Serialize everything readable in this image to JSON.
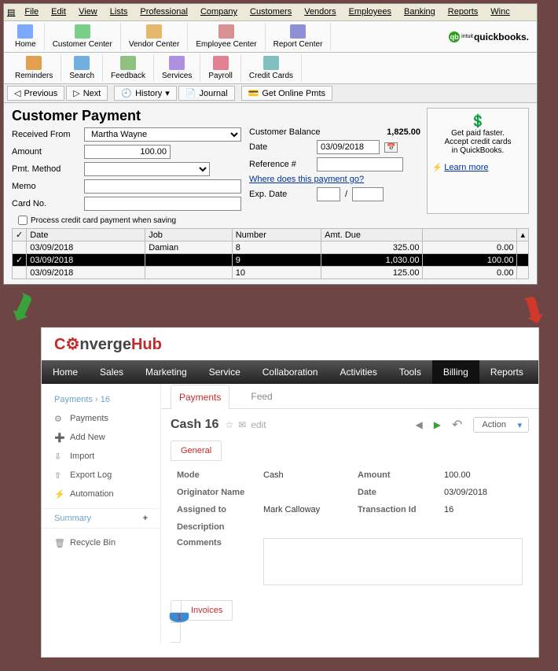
{
  "qb": {
    "menu": [
      "File",
      "Edit",
      "View",
      "Lists",
      "Professional",
      "Company",
      "Customers",
      "Vendors",
      "Employees",
      "Banking",
      "Reports",
      "Winc"
    ],
    "toolbar1": [
      {
        "label": "Home",
        "color": "#7aa9ff"
      },
      {
        "label": "Customer Center",
        "color": "#7ad088"
      },
      {
        "label": "Vendor Center",
        "color": "#e6b86a"
      },
      {
        "label": "Employee Center",
        "color": "#d89090"
      },
      {
        "label": "Report Center",
        "color": "#9090d8"
      }
    ],
    "brand_small": "intuit",
    "brand": "quickbooks",
    "toolbar2": [
      {
        "label": "Reminders",
        "color": "#e0a050"
      },
      {
        "label": "Search",
        "color": "#70b0e0"
      },
      {
        "label": "Feedback",
        "color": "#90c080"
      },
      {
        "label": "Services",
        "color": "#b090e0"
      },
      {
        "label": "Payroll",
        "color": "#e08090"
      },
      {
        "label": "Credit Cards",
        "color": "#80c0c0"
      }
    ],
    "nav": {
      "prev": "Previous",
      "next": "Next",
      "history": "History",
      "journal": "Journal",
      "online": "Get Online Pmts"
    },
    "title": "Customer Payment",
    "received_label": "Received From",
    "received_value": "Martha Wayne",
    "bal_label": "Customer Balance",
    "bal_value": "1,825.00",
    "amount_label": "Amount",
    "amount_value": "100.00",
    "date_label": "Date",
    "date_value": "03/09/2018",
    "pmt_label": "Pmt. Method",
    "pmt_value": "",
    "ref_label": "Reference #",
    "ref_value": "",
    "memo_label": "Memo",
    "memo_value": "",
    "where_link": "Where does this payment go?",
    "card_label": "Card No.",
    "card_value": "",
    "exp_label": "Exp. Date",
    "exp_m": "",
    "exp_y": "",
    "process_label": "Process credit card payment when saving",
    "promo": {
      "line1": "Get paid faster.",
      "line2": "Accept credit cards",
      "line3": "in QuickBooks.",
      "learn": "Learn more"
    },
    "table": {
      "headers": {
        "check": "✓",
        "date": "Date",
        "job": "Job",
        "number": "Number",
        "amtdue": "Amt. Due",
        "last": ""
      },
      "rows": [
        {
          "date": "03/09/2018",
          "job": "Damian",
          "number": "8",
          "amtdue": "325.00",
          "last": "0.00",
          "sel": false
        },
        {
          "date": "03/09/2018",
          "job": "",
          "number": "9",
          "amtdue": "1,030.00",
          "last": "100.00",
          "sel": true
        },
        {
          "date": "03/09/2018",
          "job": "",
          "number": "10",
          "amtdue": "125.00",
          "last": "0.00",
          "sel": false
        }
      ]
    }
  },
  "ch": {
    "logo": {
      "c": "C",
      "mid": "nverge",
      "hub": "Hub"
    },
    "nav": [
      "Home",
      "Sales",
      "Marketing",
      "Service",
      "Collaboration",
      "Activities",
      "Tools",
      "Billing",
      "Reports"
    ],
    "nav_active": "Billing",
    "breadcrumb": {
      "a": "Payments",
      "sep": "›",
      "b": "16"
    },
    "sidebar": [
      {
        "icon": "⚙",
        "label": "Payments"
      },
      {
        "icon": "➕",
        "label": "Add New"
      },
      {
        "icon": "⇩",
        "label": "Import"
      },
      {
        "icon": "⇧",
        "label": "Export Log"
      },
      {
        "icon": "⚡",
        "label": "Automation"
      }
    ],
    "summary": "Summary",
    "recycle": {
      "icon": "🗑",
      "label": "Recycle Bin"
    },
    "tabs": {
      "payments": "Payments",
      "feed": "Feed"
    },
    "heading": "Cash 16",
    "edit": "edit",
    "action": "Action",
    "sub_general": "General",
    "fields": {
      "mode_l": "Mode",
      "mode_v": "Cash",
      "amount_l": "Amount",
      "amount_v": "100.00",
      "orig_l": "Originator Name",
      "orig_v": "",
      "date_l": "Date",
      "date_v": "03/09/2018",
      "assigned_l": "Assigned to",
      "assigned_v": "Mark Calloway",
      "txn_l": "Transaction Id",
      "txn_v": "16",
      "desc_l": "Description",
      "desc_v": "",
      "comments_l": "Comments"
    },
    "inv_tab": "Invoices",
    "inv_badge": "1"
  }
}
